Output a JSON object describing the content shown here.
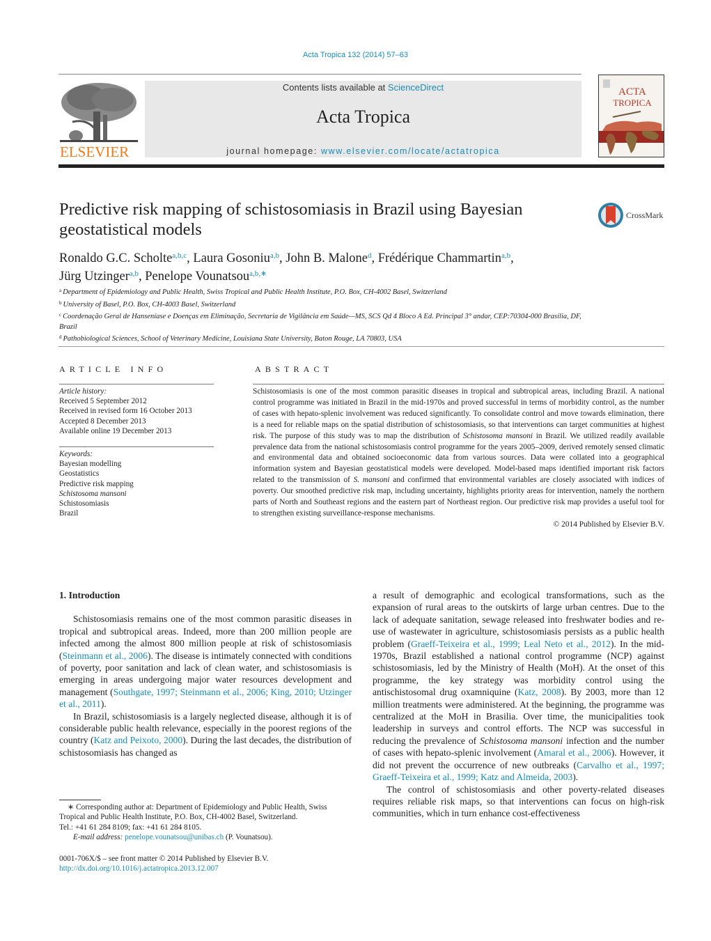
{
  "header": {
    "journal_ref": "Acta Tropica 132 (2014) 57–63",
    "contents_prefix": "Contents lists available at ",
    "contents_link": "ScienceDirect",
    "journal_title": "Acta Tropica",
    "homepage_prefix": "journal homepage: ",
    "homepage_link": "www.elsevier.com/locate/actatropica",
    "publisher_logo_text": "ELSEVIER",
    "cover_title_line1": "ACTA",
    "cover_title_line2": "TROPICA",
    "crossmark_label": "CrossMark"
  },
  "colors": {
    "link": "#1a8bb5",
    "elsevier_orange": "#f07a1a",
    "masthead_bg": "#e8e8e8"
  },
  "article": {
    "title": "Predictive risk mapping of schistosomiasis in Brazil using Bayesian geostatistical models",
    "authors": [
      {
        "name": "Ronaldo G.C. Scholte",
        "affil": "a,b,c",
        "sep": ", "
      },
      {
        "name": "Laura Gosoniu",
        "affil": "a,b",
        "sep": ", "
      },
      {
        "name": "John B. Malone",
        "affil": "d",
        "sep": ", "
      },
      {
        "name": "Frédérique Chammartin",
        "affil": "a,b",
        "sep": ","
      },
      {
        "name": "Jürg Utzinger",
        "affil": "a,b",
        "sep": ", "
      },
      {
        "name": "Penelope Vounatsou",
        "affil": "a,b,∗",
        "sep": ""
      }
    ],
    "affiliations": [
      {
        "key": "a",
        "text": "Department of Epidemiology and Public Health, Swiss Tropical and Public Health Institute, P.O. Box, CH-4002 Basel, Switzerland"
      },
      {
        "key": "b",
        "text": "University of Basel, P.O. Box, CH-4003 Basel, Switzerland"
      },
      {
        "key": "c",
        "text": "Coordenação Geral de Hanseníase e Doenças em Eliminação, Secretaria de Vigilância em Saúde—MS, SCS Qd 4 Bloco A Ed. Principal 3° andar, CEP:70304-000 Brasília, DF, Brazil"
      },
      {
        "key": "d",
        "text": "Pathobiological Sciences, School of Veterinary Medicine, Louisiana State University, Baton Rouge, LA 70803, USA"
      }
    ]
  },
  "article_info": {
    "heading": "ARTICLE INFO",
    "history_label": "Article history:",
    "history": [
      "Received 5 September 2012",
      "Received in revised form 16 October 2013",
      "Accepted 8 December 2013",
      "Available online 19 December 2013"
    ],
    "keywords_label": "Keywords:",
    "keywords": [
      {
        "text": "Bayesian modelling",
        "italic": false
      },
      {
        "text": "Geostatistics",
        "italic": false
      },
      {
        "text": "Predictive risk mapping",
        "italic": false
      },
      {
        "text": "Schistosoma mansoni",
        "italic": true
      },
      {
        "text": "Schistosomiasis",
        "italic": false
      },
      {
        "text": "Brazil",
        "italic": false
      }
    ]
  },
  "abstract": {
    "heading": "ABSTRACT",
    "part1": "Schistosomiasis is one of the most common parasitic diseases in tropical and subtropical areas, including Brazil. A national control programme was initiated in Brazil in the mid-1970s and proved successful in terms of morbidity control, as the number of cases with hepato-splenic involvement was reduced significantly. To consolidate control and move towards elimination, there is a need for reliable maps on the spatial distribution of schistosomiasis, so that interventions can target communities at highest risk. The purpose of this study was to map the distribution of ",
    "italic1": "Schistosoma mansoni",
    "part2": " in Brazil. We utilized readily available prevalence data from the national schistosomiasis control programme for the years 2005–2009, derived remotely sensed climatic and environmental data and obtained socioeconomic data from various sources. Data were collated into a geographical information system and Bayesian geostatistical models were developed. Model-based maps identified important risk factors related to the transmission of ",
    "italic2": "S. mansoni",
    "part3": " and confirmed that environmental variables are closely associated with indices of poverty. Our smoothed predictive risk map, including uncertainty, highlights priority areas for intervention, namely the northern parts of North and Southeast regions and the eastern part of Northeast region. Our predictive risk map provides a useful tool for to strengthen existing surveillance-response mechanisms.",
    "copyright": "© 2014 Published by Elsevier B.V."
  },
  "introduction": {
    "heading": "1.  Introduction",
    "p1": {
      "t1": "Schistosomiasis remains one of the most common parasitic diseases in tropical and subtropical areas. Indeed, more than 200 million people are infected among the almost 800 million people at risk of schistosomiasis (",
      "c1": "Steinmann et al., 2006",
      "t2": "). The disease is intimately connected with conditions of poverty, poor sanitation and lack of clean water, and schistosomiasis is emerging in areas undergoing major water resources development and management (",
      "c2": "Southgate, 1997; Steinmann et al., 2006; King, 2010; Utzinger et al., 2011",
      "t3": ")."
    },
    "p2": {
      "t1": "In Brazil, schistosomiasis is a largely neglected disease, although it is of considerable public health relevance, especially in the poorest regions of the country (",
      "c1": "Katz and Peixoto, 2000",
      "t2": "). During the last decades, the distribution of schistosomiasis has changed as a result of demographic and ecological transformations, such as the expansion of rural areas to the outskirts of large urban centres. Due to the lack of adequate sanitation, sewage released into freshwater bodies and re-use of wastewater in agriculture, schistosomiasis persists as a public health problem (",
      "c2": "Graeff-Teixeira et al., 1999; Leal Neto et al., 2012",
      "t3": "). In the mid-1970s, Brazil established a national control programme (NCP) against schistosomiasis, led by the Ministry of Health (MoH). At the onset of this programme, the key strategy was morbidity control using the antischistosomal drug oxamniquine (",
      "c3": "Katz, 2008",
      "t4": "). By 2003, more than 12 million treatments were administered. At the beginning, the programme was centralized at the MoH in Brasilia. Over time, the municipalities took leadership in surveys and control efforts. The NCP was successful in reducing the prevalence of ",
      "i1": "Schistosoma mansoni",
      "t5": " infection and the number of cases with hepato-splenic involvement (",
      "c4": "Amaral et al., 2006",
      "t6": "). However, it did not prevent the occurrence of new outbreaks (",
      "c5": "Carvalho et al., 1997; Graeff-Teixeira et al., 1999; Katz and Almeida, 2003",
      "t7": ")."
    },
    "p3": {
      "t1": "The control of schistosomiasis and other poverty-related diseases requires reliable risk maps, so that interventions can focus on high-risk communities, which in turn enhance cost-effectiveness"
    }
  },
  "footnotes": {
    "corresponding": "∗  Corresponding author at: Department of Epidemiology and Public Health, Swiss Tropical and Public Health Institute, P.O. Box, CH-4002 Basel, Switzerland.",
    "tel": "Tel.: +41 61 284 8109; fax: +41 61 284 8105.",
    "email_label": "E-mail address: ",
    "email": "penelope.vounatsou@unibas.ch",
    "email_suffix": " (P. Vounatsou).",
    "front_matter": "0001-706X/$ – see front matter © 2014 Published by Elsevier B.V.",
    "doi": "http://dx.doi.org/10.1016/j.actatropica.2013.12.007"
  }
}
